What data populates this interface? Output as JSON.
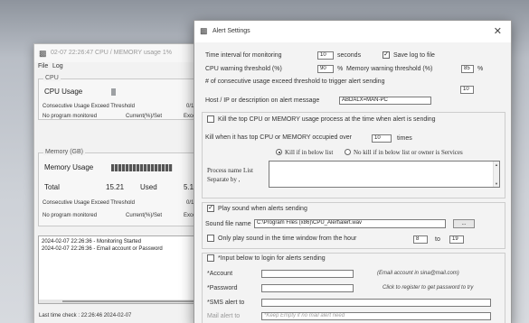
{
  "main_window": {
    "title": "02-07 22:26:47 CPU / MEMORY usage 1%",
    "menu": [
      "File",
      "Log"
    ],
    "cpu": {
      "legend": "CPU",
      "usage_label": "CPU Usage",
      "usage_level": 0.03,
      "threshold_label": "Consecutive Usage Exceed Threshold",
      "threshold_value": "0/10",
      "monitor_label": "No program monitored",
      "current_label": "Current(%)/Set",
      "exceed_label": "Exce"
    },
    "memory": {
      "legend": "Memory (GB)",
      "usage_label": "Memory Usage",
      "usage_level": 0.45,
      "total_label": "Total",
      "total_value": "15.21",
      "used_label": "Used",
      "used_value": "5.1",
      "threshold_label": "Consecutive Usage Exceed Threshold",
      "threshold_value": "0/10",
      "monitor_label": "No program monitored",
      "current_label": "Current(%)/Set",
      "exceed_label": "Exce"
    },
    "log_lines": [
      "2024-02-07 22:26:36 - Monitoring Started",
      "2024-02-07 22:26:36 - Email account or Password"
    ],
    "last_check": "Last time check :  22:26:46 2024-02-07"
  },
  "dialog": {
    "title": "Alert Settings",
    "close_glyph": "✕",
    "interval_label": "Time interval for monitoring",
    "interval_value": "10",
    "interval_unit": "seconds",
    "save_log_label": "Save log to file",
    "save_log_checked": true,
    "cpu_threshold_label": "CPU warning threshold (%)",
    "cpu_threshold_value": "90",
    "percent": "%",
    "mem_threshold_label": "Memory warning threshold (%)",
    "mem_threshold_value": "85",
    "consecutive_label": "# of consecutive usage exceed threshold to trigger alert sending",
    "consecutive_value": "10",
    "host_label": "Host / IP or description on alert message",
    "host_value": "ABDALX=MAN-PC",
    "kill_top_label": "Kill the top CPU or MEMORY usage process at the time when alert is sending",
    "kill_top_checked": false,
    "kill_when_label": "Kill when it has top CPU or MEMORY occupied over",
    "kill_when_value": "10",
    "kill_when_unit": "times",
    "radio_kill_if": "Kill if in below list",
    "radio_no_kill": "No kill if in below list or owner is Services",
    "process_list_label_1": "Process name List",
    "process_list_label_2": "Separate by ,",
    "play_sound_label": "Play sound when alerts sending",
    "play_sound_checked": true,
    "sound_file_label": "Sound file name",
    "sound_file_value": "C:\\Program Files (x86)\\CPU_Alert\\alert.wav",
    "browse_label": "...",
    "only_play_label": "Only play sound in the time window from the hour",
    "only_play_checked": false,
    "hour_from": "8",
    "hour_to_label": "to",
    "hour_to": "19",
    "login_section_label": "*Input below to login for alerts sending",
    "login_section_checked": false,
    "account_label": "*Account",
    "account_hint": "(Email account in sina@mail.com)",
    "password_label": "*Password",
    "password_hint": "Click to register to get password to try",
    "sms_label": "*SMS alert to",
    "mail_label": "Mail alert to",
    "mail_placeholder": "*Keep Empty if no mail alert need"
  }
}
